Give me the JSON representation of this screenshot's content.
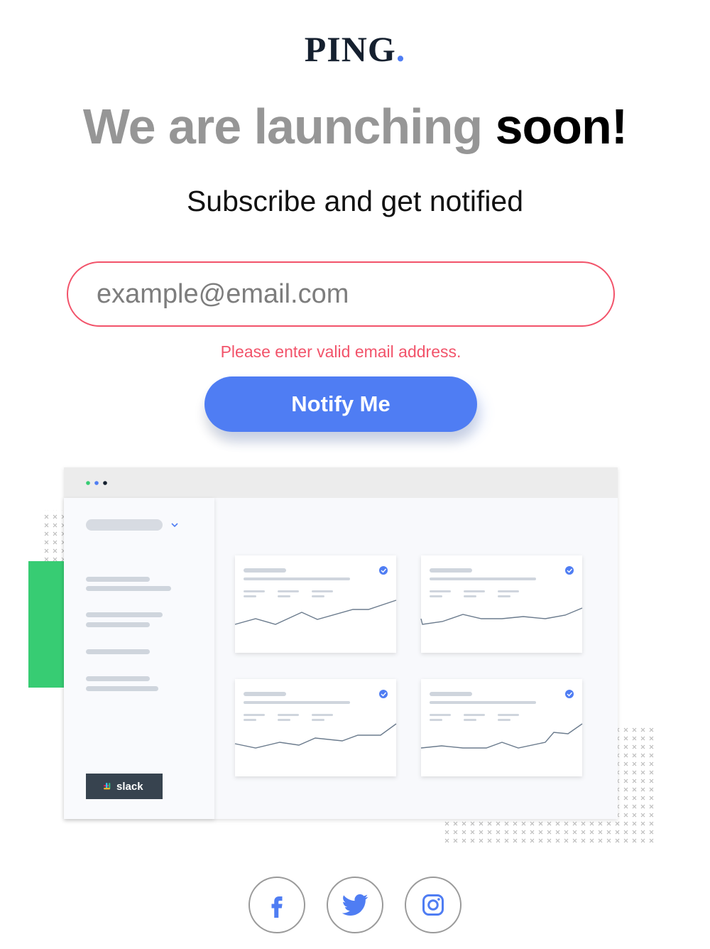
{
  "brand": {
    "name": "PING",
    "dot": "."
  },
  "hero": {
    "title_light": "We are launching",
    "title_bold": "soon!",
    "subtitle": "Subscribe and get notified"
  },
  "form": {
    "email_placeholder": "example@email.com",
    "error": "Please enter valid email address.",
    "button_label": "Notify Me"
  },
  "illustration": {
    "integration_label": "slack"
  },
  "social": [
    {
      "icon": "facebook-icon"
    },
    {
      "icon": "twitter-icon"
    },
    {
      "icon": "instagram-icon"
    }
  ],
  "colors": {
    "accent": "#4f7df3",
    "error": "#f2536a",
    "green": "#37cc73",
    "dark": "#15202f"
  }
}
